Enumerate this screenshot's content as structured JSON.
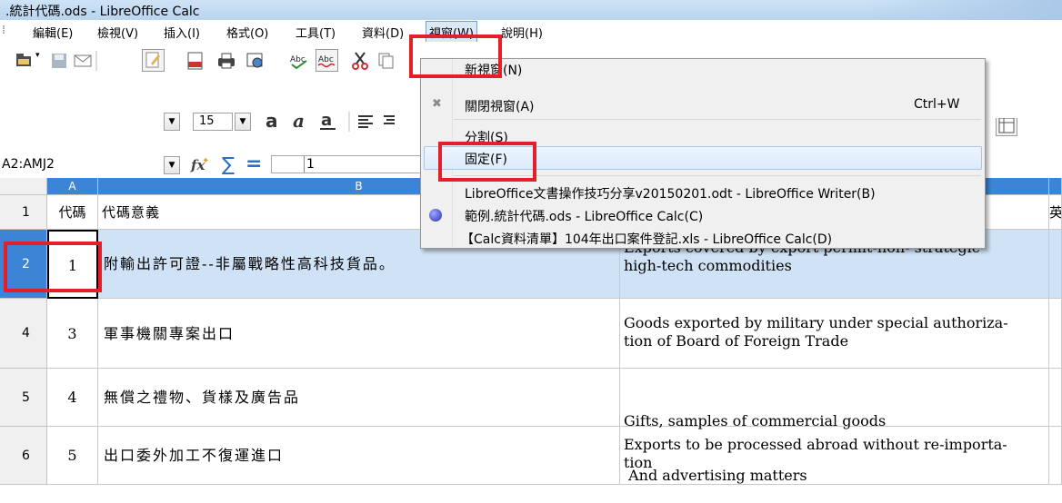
{
  "window": {
    "title": ".統計代碼.ods - LibreOffice Calc"
  },
  "menubar": {
    "items": [
      {
        "label": "編輯(E)"
      },
      {
        "label": "檢視(V)"
      },
      {
        "label": "插入(I)"
      },
      {
        "label": "格式(O)"
      },
      {
        "label": "工具(T)"
      },
      {
        "label": "資料(D)"
      },
      {
        "label": "視窗(W)"
      },
      {
        "label": "說明(H)"
      }
    ]
  },
  "font_size": "15",
  "name_box": "A2:AMJ2",
  "formula_input": "1",
  "window_menu": {
    "new_window": "新視窗(N)",
    "close_window": "關閉視窗(A)",
    "close_shortcut": "Ctrl+W",
    "split": "分割(S)",
    "freeze": "固定(F)",
    "docs": [
      "LibreOffice文書操作技巧分享v20150201.odt - LibreOffice Writer(B)",
      "範例.統計代碼.ods - LibreOffice Calc(C)",
      "【Calc資料清單】104年出口案件登記.xls - LibreOffice Calc(D)"
    ]
  },
  "columns": {
    "a": "A",
    "b": "B"
  },
  "rows": [
    {
      "num": "1",
      "a": "代碼",
      "b": "代碼意義",
      "c": "",
      "d": "英"
    },
    {
      "num": "2",
      "a": "1",
      "b": "附輸出許可證--非屬戰略性高科技貨品。",
      "c1": "Exports covered by export permit-non- strategic",
      "c2": "high-tech commodities"
    },
    {
      "num": "4",
      "a": "3",
      "b": "軍事機關專案出口",
      "c1": "Goods exported by military under special authoriza-",
      "c2": "tion of Board of Foreign Trade"
    },
    {
      "num": "5",
      "a": "4",
      "b": "無償之禮物、貨樣及廣告品",
      "c1": "Gifts, samples of commercial goods",
      "c2": " And advertising matters"
    },
    {
      "num": "6",
      "a": "5",
      "b": "出口委外加工不復運進口",
      "c1": "Exports to be processed abroad without re-importa-",
      "c2": "tion"
    }
  ],
  "colors": {
    "accent": "#e51f2a",
    "selection": "#cfe2f6",
    "header": "#f0f0f0"
  }
}
